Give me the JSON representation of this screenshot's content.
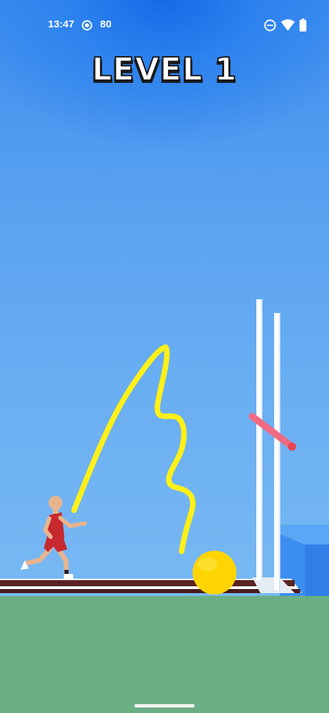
{
  "status_bar": {
    "time": "13:47",
    "indicator_value": "80",
    "icons": [
      "screen-record-icon",
      "do-not-disturb-icon",
      "wifi-icon",
      "battery-icon"
    ]
  },
  "hud": {
    "level_label": "LEVEL 1"
  },
  "colors": {
    "sky_top": "#1568e6",
    "sky_bottom": "#78b9f3",
    "ground": "#6aae84",
    "drawn_line": "#fff018",
    "ball": "#ffd400",
    "crossbar": "#f06a82",
    "landing_mat": "#3c8ff0",
    "track": "#5a2323"
  },
  "scene": {
    "character": "runner-athlete",
    "objects": [
      "drawn-yellow-line",
      "yellow-ball",
      "high-jump-posts",
      "high-jump-crossbar",
      "landing-mat",
      "running-track"
    ]
  }
}
